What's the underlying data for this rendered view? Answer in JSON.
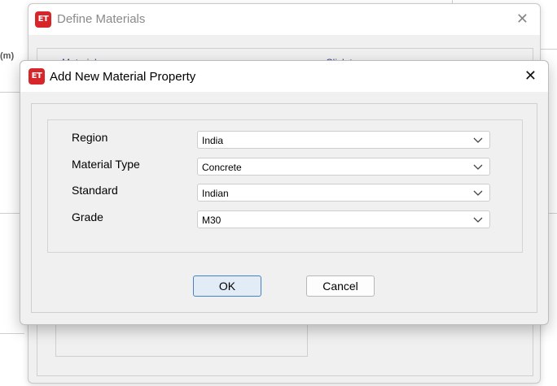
{
  "background": {
    "unit_label": "(m)"
  },
  "back_window": {
    "title": "Define Materials",
    "icon": "ET",
    "close_glyph": "✕",
    "list_header_left": "Material",
    "list_header_right": "Click to:"
  },
  "dialog": {
    "title": "Add New Material Property",
    "icon": "ET",
    "close_glyph": "✕",
    "fields": [
      {
        "label": "Region",
        "value": "India"
      },
      {
        "label": "Material Type",
        "value": "Concrete"
      },
      {
        "label": "Standard",
        "value": "Indian"
      },
      {
        "label": "Grade",
        "value": "M30"
      }
    ],
    "ok_label": "OK",
    "cancel_label": "Cancel"
  }
}
